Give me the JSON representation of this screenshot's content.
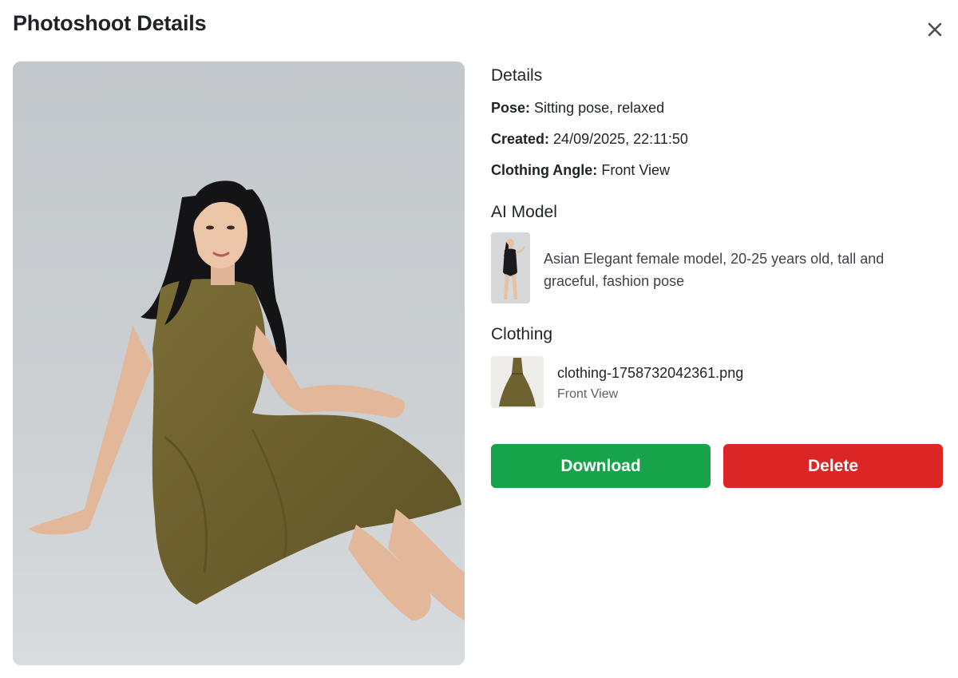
{
  "modal": {
    "title": "Photoshoot Details",
    "close_icon": "close-icon"
  },
  "photo": {
    "alt": "Model sitting in an olive sleeveless dress"
  },
  "details": {
    "heading": "Details",
    "pose_label": "Pose:",
    "pose_value": "Sitting pose, relaxed",
    "created_label": "Created:",
    "created_value": "24/09/2025, 22:11:50",
    "angle_label": "Clothing Angle:",
    "angle_value": "Front View"
  },
  "ai_model": {
    "heading": "AI Model",
    "description": "Asian Elegant female model, 20-25 years old, tall and graceful, fashion pose"
  },
  "clothing": {
    "heading": "Clothing",
    "filename": "clothing-1758732042361.png",
    "angle": "Front View"
  },
  "actions": {
    "download_label": "Download",
    "delete_label": "Delete"
  },
  "colors": {
    "download": "#16a34a",
    "delete": "#dc2626",
    "dress": "#6e6230",
    "backdrop": "#c4c9cd"
  }
}
